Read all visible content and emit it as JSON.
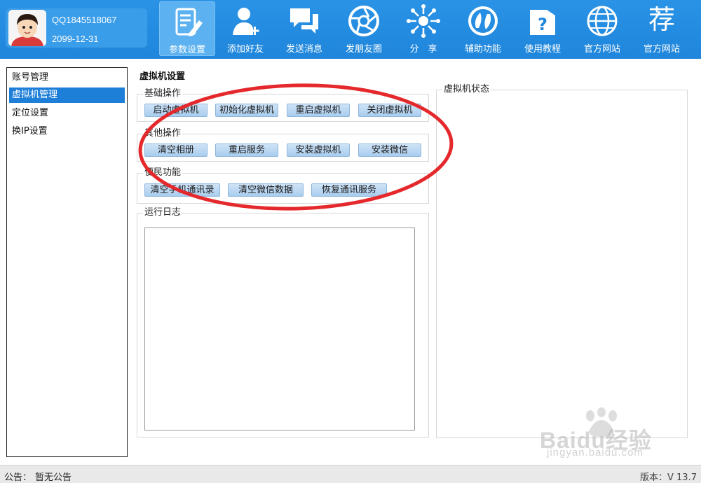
{
  "user": {
    "qq": "QQ1845518067",
    "expiry": "2099-12-31"
  },
  "toolbar": {
    "items": [
      {
        "label": "参数设置",
        "icon": "settings-doc-icon"
      },
      {
        "label": "添加好友",
        "icon": "add-user-icon"
      },
      {
        "label": "发送消息",
        "icon": "chat-bubbles-icon"
      },
      {
        "label": "发朋友圈",
        "icon": "aperture-icon"
      },
      {
        "label": "分　享",
        "icon": "share-burst-icon"
      },
      {
        "label": "辅助功能",
        "icon": "helper-icon"
      },
      {
        "label": "使用教程",
        "icon": "help-folder-icon"
      },
      {
        "label": "官方网站",
        "icon": "globe-icon"
      },
      {
        "label": "官方网站",
        "icon": "recommend-icon",
        "icon_text": "荐"
      }
    ],
    "active_index": 0
  },
  "nav": {
    "items": [
      "账号管理",
      "虚拟机管理",
      "定位设置",
      "换IP设置"
    ],
    "selected_index": 1
  },
  "main": {
    "title": "虚拟机设置",
    "basic": {
      "legend": "基础操作",
      "buttons": [
        "启动虚拟机",
        "初始化虚拟机",
        "重启虚拟机",
        "关闭虚拟机"
      ]
    },
    "other": {
      "legend": "其他操作",
      "buttons": [
        "清空相册",
        "重启服务",
        "安装虚拟机",
        "安装微信"
      ]
    },
    "convenience": {
      "legend": "便民功能",
      "buttons": [
        "清空手机通讯录",
        "清空微信数据",
        "恢复通讯服务"
      ]
    },
    "log": {
      "legend": "运行日志"
    },
    "vm_status": {
      "legend": "虚拟机状态"
    }
  },
  "statusbar": {
    "notice_label": "公告：",
    "notice_text": "暂无公告",
    "version": "版本：V 13.7"
  },
  "watermark": {
    "brand": "Baidu经验",
    "url": "jingyan.baidu.com"
  },
  "colors": {
    "toolbar": "#1f86db",
    "selected": "#1e7fd8",
    "annotation": "#e5282b"
  }
}
